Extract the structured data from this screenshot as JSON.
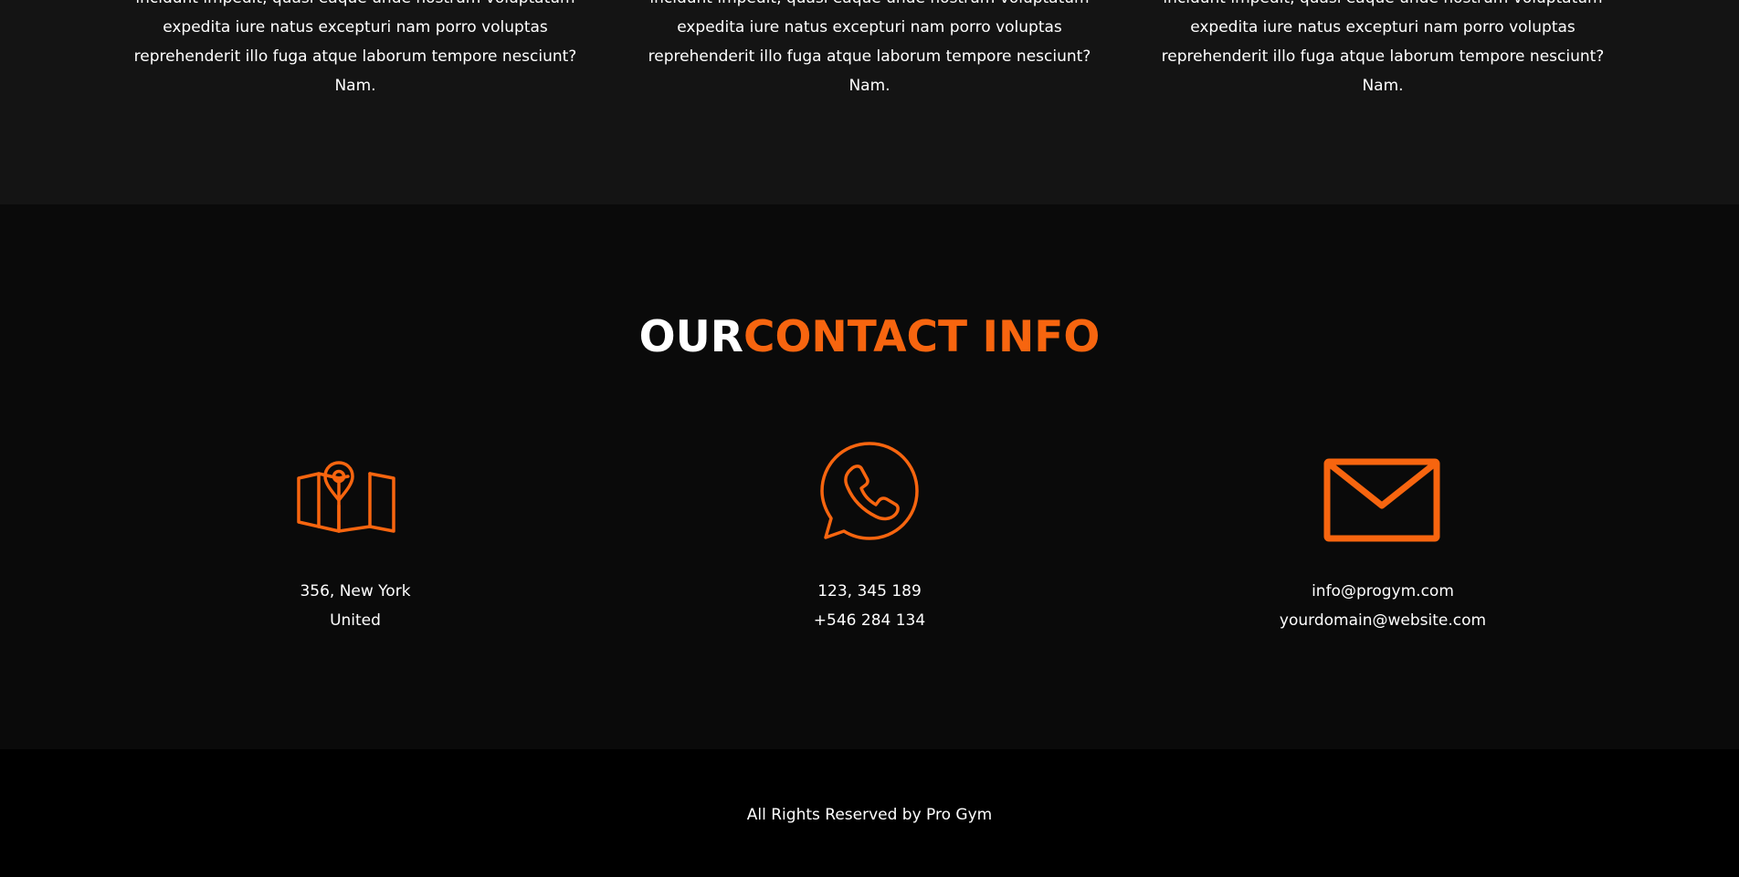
{
  "testimonials": [
    {
      "lines": [
        "incidunt impedit, quasi eaque unde nostrum voluptatum",
        "expedita iure natus excepturi nam porro voluptas",
        "reprehenderit illo fuga atque laborum tempore nesciunt?",
        "Nam."
      ]
    },
    {
      "lines": [
        "incidunt impedit, quasi eaque unde nostrum voluptatum",
        "expedita iure natus excepturi nam porro voluptas",
        "reprehenderit illo fuga atque laborum tempore nesciunt?",
        "Nam."
      ]
    },
    {
      "lines": [
        "incidunt impedit, quasi eaque unde nostrum voluptatum",
        "expedita iure natus excepturi nam porro voluptas",
        "reprehenderit illo fuga atque laborum tempore nesciunt?",
        "Nam."
      ]
    }
  ],
  "contact": {
    "heading_white": "OUR",
    "heading_orange": "CONTACT INFO",
    "accent_color": "#f7650f",
    "items": [
      {
        "icon": "map-location-icon",
        "line1": "356, New York",
        "line2": "United"
      },
      {
        "icon": "whatsapp-phone-icon",
        "line1": "123, 345 189",
        "line2": "+546 284 134"
      },
      {
        "icon": "envelope-icon",
        "line1": "info@progym.com",
        "line2": "yourdomain@website.com"
      }
    ]
  },
  "footer": {
    "text": "All Rights Reserved by Pro Gym"
  }
}
